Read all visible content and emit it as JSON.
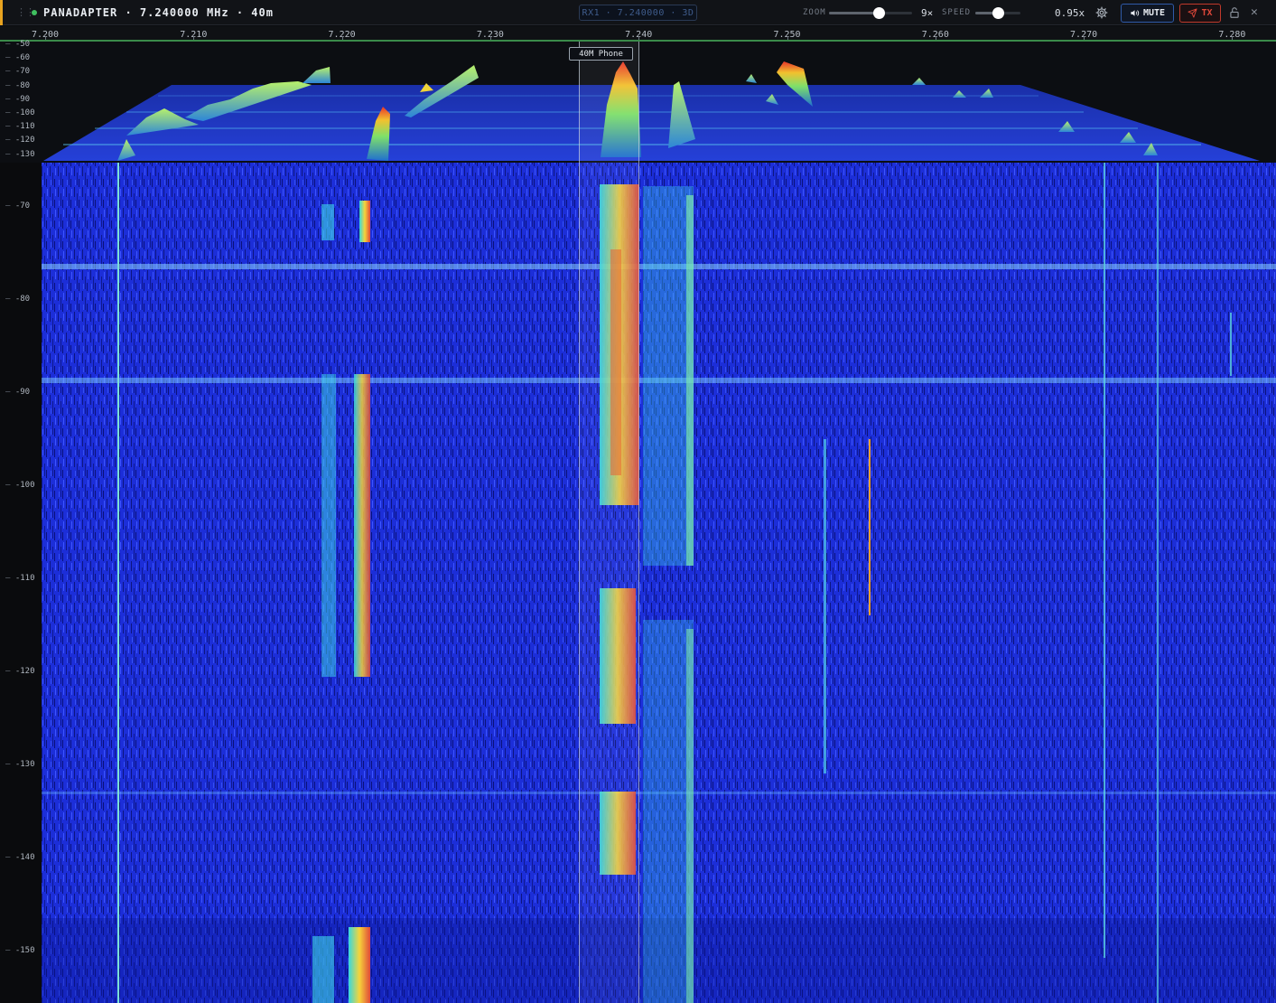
{
  "titlebar": {
    "title": "PANADAPTER · 7.240000 MHz · 40m",
    "vfo_readout": "RX1 · 7.240000 · 3D",
    "zoom_label": "ZOOM",
    "zoom_value": "9×",
    "zoom_level": 0.6,
    "speed_label": "SPEED",
    "speed_value": "0.95x",
    "speed_level": 0.5,
    "mute_label": "MUTE",
    "tx_label": "TX"
  },
  "freq_axis": {
    "ticks": [
      "7.200",
      "7.210",
      "7.220",
      "7.230",
      "7.240",
      "7.250",
      "7.260",
      "7.270",
      "7.280"
    ]
  },
  "db_axis": {
    "spectrum_labels": [
      "-50",
      "-60",
      "-70",
      "-80",
      "-90",
      "-100",
      "-110",
      "-120",
      "-130"
    ],
    "waterfall_labels": [
      "-70",
      "-80",
      "-90",
      "-100",
      "-110",
      "-120",
      "-130",
      "-140",
      "-150"
    ]
  },
  "band_marker": {
    "label": "40M Phone"
  },
  "colors": {
    "accent": "#e8a320",
    "status_on": "#3fbf5f",
    "mute_border": "#2f5aa8",
    "tx_red": "#e0473a",
    "waterfall_base": "#1d2fd6",
    "axis_green": "#3a8a4a"
  },
  "icons": [
    "drag-handle-icon",
    "status-dot-icon",
    "gear-icon",
    "speaker-icon",
    "send-icon",
    "lock-icon",
    "close-icon"
  ]
}
